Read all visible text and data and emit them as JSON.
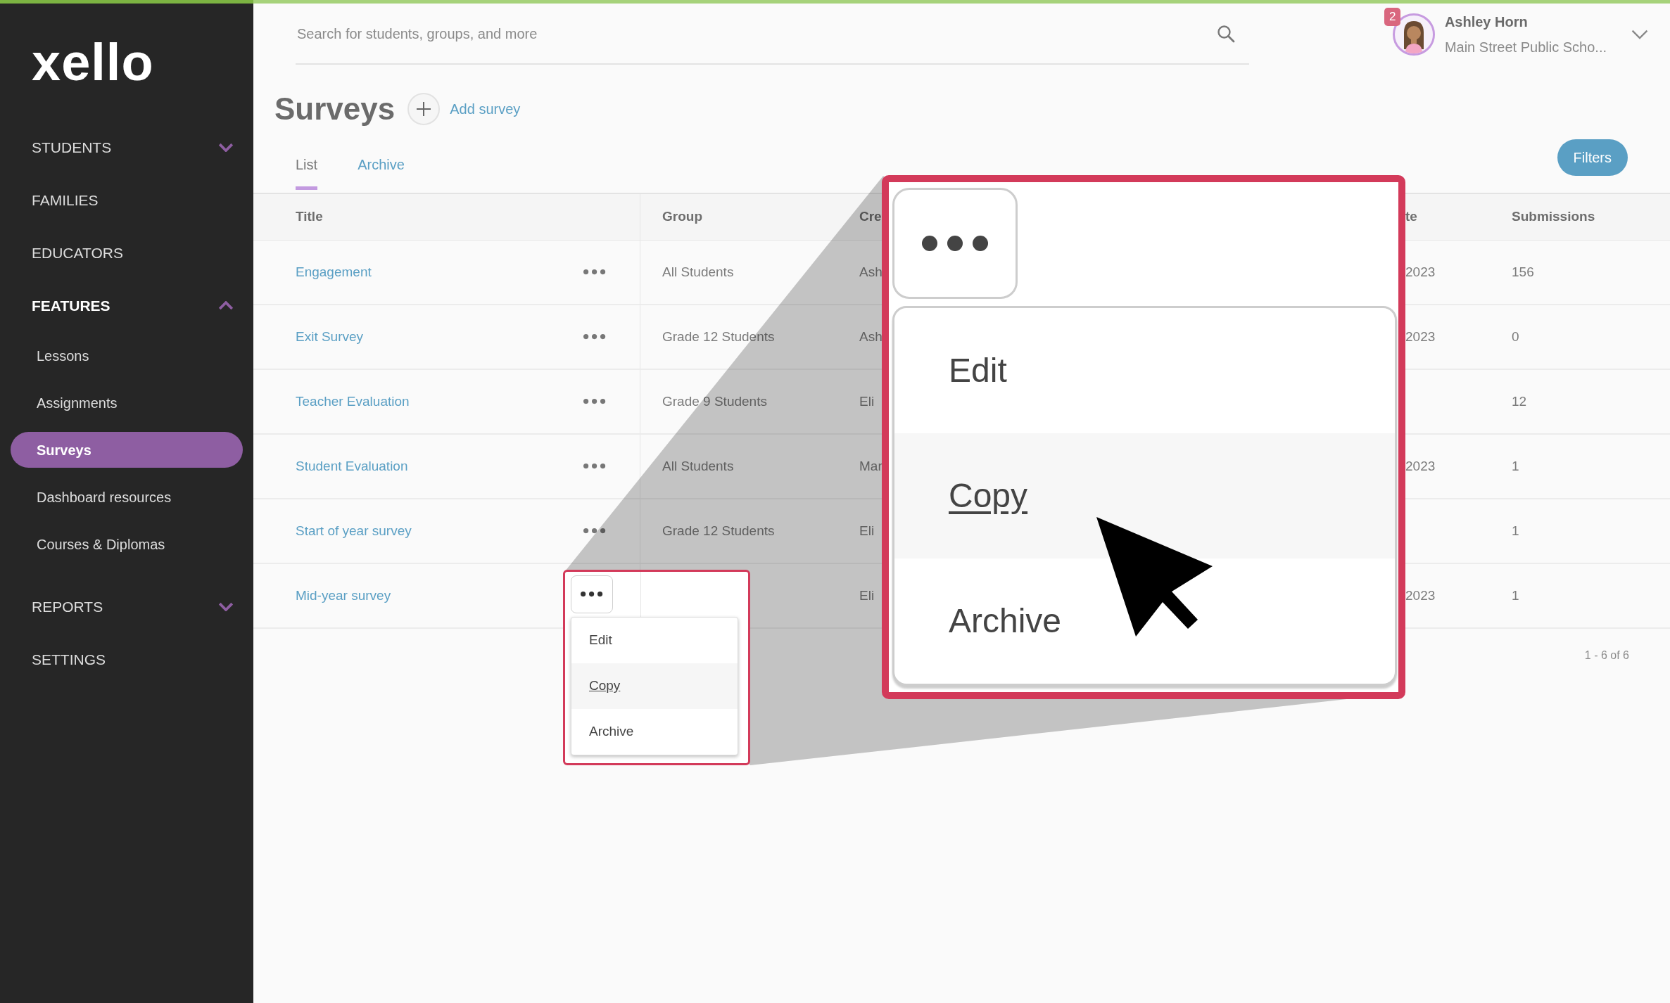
{
  "logo": "xello",
  "sidebar": [
    {
      "label": "STUDENTS",
      "kind": "group",
      "expanded": false,
      "active": false
    },
    {
      "label": "FAMILIES",
      "kind": "link",
      "active": false
    },
    {
      "label": "EDUCATORS",
      "kind": "link",
      "active": false
    },
    {
      "label": "FEATURES",
      "kind": "group",
      "expanded": true,
      "active": true,
      "children": [
        {
          "label": "Lessons",
          "selected": false
        },
        {
          "label": "Assignments",
          "selected": false
        },
        {
          "label": "Surveys",
          "selected": true
        },
        {
          "label": "Dashboard resources",
          "selected": false
        },
        {
          "label": "Courses & Diplomas",
          "selected": false
        }
      ]
    },
    {
      "label": "REPORTS",
      "kind": "group",
      "expanded": false,
      "active": false
    },
    {
      "label": "SETTINGS",
      "kind": "link",
      "active": false
    }
  ],
  "search": {
    "placeholder": "Search for students, groups, and more"
  },
  "user": {
    "name": "Ashley Horn",
    "school": "Main Street Public Scho...",
    "notifications": "2"
  },
  "page": {
    "title": "Surveys",
    "add_label": "Add survey"
  },
  "tabs": [
    {
      "label": "List",
      "selected": true
    },
    {
      "label": "Archive",
      "selected": false
    }
  ],
  "filters_button": "Filters",
  "table": {
    "columns": [
      "Title",
      "Group",
      "Cre",
      "te",
      "Submissions"
    ],
    "rows": [
      {
        "title": "Engagement",
        "group": "All Students",
        "created_by": "Ash",
        "date": "2023",
        "submissions": "156",
        "menu_open": false
      },
      {
        "title": "Exit Survey",
        "group": "Grade 12 Students",
        "created_by": "Ash",
        "date": "2023",
        "submissions": "0",
        "menu_open": false
      },
      {
        "title": "Teacher Evaluation",
        "group": "Grade 9 Students",
        "created_by": "Eli",
        "submissions": "12",
        "menu_open": false
      },
      {
        "title": "Student Evaluation",
        "group": "All Students",
        "created_by": "Mar",
        "date": "2023",
        "submissions": "1",
        "menu_open": false
      },
      {
        "title": "Start of year survey",
        "group": "Grade 12 Students",
        "created_by": "Eli",
        "submissions": "1",
        "menu_open": false
      },
      {
        "title": "Mid-year survey",
        "created_by": "Eli",
        "date": "2023",
        "submissions": "1",
        "menu_open": true
      }
    ]
  },
  "pagination": "1 - 6 of 6",
  "row_menu": [
    {
      "label": "Edit",
      "highlighted": false
    },
    {
      "label": "Copy",
      "highlighted": true
    },
    {
      "label": "Archive",
      "highlighted": false
    }
  ],
  "callout": {
    "menu": [
      {
        "label": "Edit",
        "highlighted": false
      },
      {
        "label": "Copy",
        "highlighted": true
      },
      {
        "label": "Archive",
        "highlighted": false
      }
    ]
  }
}
